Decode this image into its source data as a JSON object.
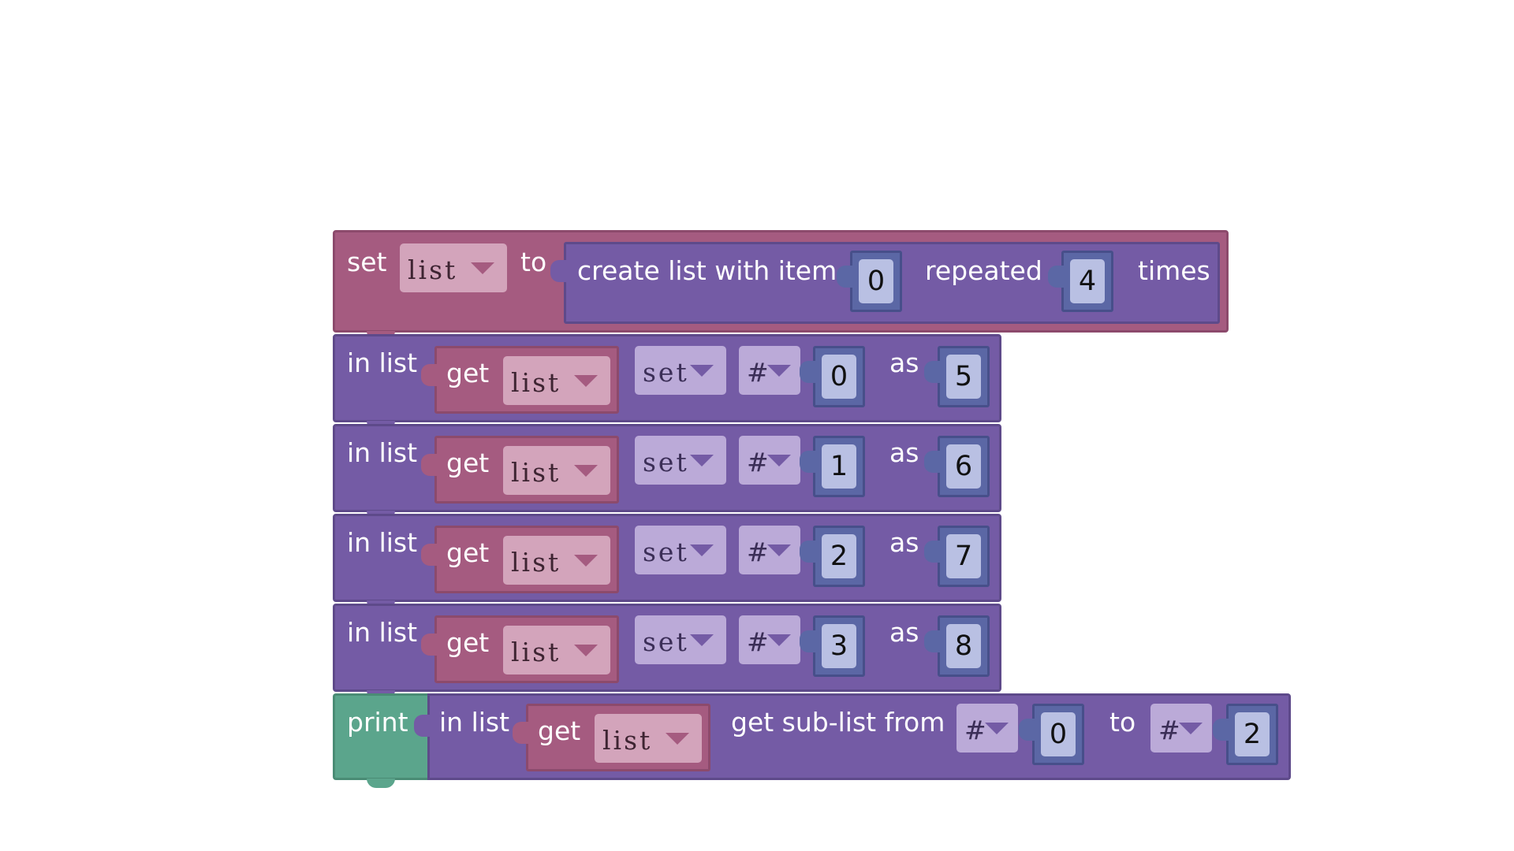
{
  "set_block": {
    "label_set": "set",
    "variable": "list",
    "label_to": "to",
    "create": {
      "label": "create list with item",
      "item": "0",
      "label_repeated": "repeated",
      "count": "4",
      "label_times": "times"
    }
  },
  "set_rows": [
    {
      "label_in_list": "in list",
      "get_label": "get",
      "variable": "list",
      "mode": "set",
      "where": "#",
      "index": "0",
      "label_as": "as",
      "value": "5"
    },
    {
      "label_in_list": "in list",
      "get_label": "get",
      "variable": "list",
      "mode": "set",
      "where": "#",
      "index": "1",
      "label_as": "as",
      "value": "6"
    },
    {
      "label_in_list": "in list",
      "get_label": "get",
      "variable": "list",
      "mode": "set",
      "where": "#",
      "index": "2",
      "label_as": "as",
      "value": "7"
    },
    {
      "label_in_list": "in list",
      "get_label": "get",
      "variable": "list",
      "mode": "set",
      "where": "#",
      "index": "3",
      "label_as": "as",
      "value": "8"
    }
  ],
  "print_block": {
    "label": "print",
    "label_in_list": "in list",
    "get_label": "get",
    "variable": "list",
    "label_sublist": "get sub-list from",
    "from_where": "#",
    "from_index": "0",
    "label_to": "to",
    "to_where": "#",
    "to_index": "2"
  },
  "colors": {
    "variables": "#a55b80",
    "lists": "#745ba5",
    "math": "#5b67a5",
    "text": "#5ba58c"
  }
}
